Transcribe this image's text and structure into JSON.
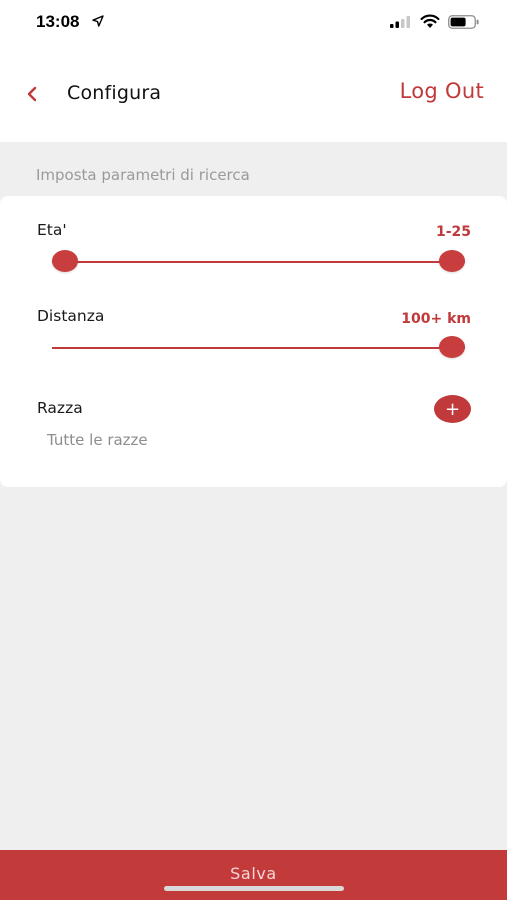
{
  "status_bar": {
    "time": "13:08",
    "icons": [
      "location-arrow-icon",
      "signal-icon",
      "wifi-icon",
      "battery-icon"
    ]
  },
  "nav": {
    "back_icon": "chevron-left-icon",
    "title": "Configura",
    "logout_label": "Log Out"
  },
  "section": {
    "label": "Imposta parametri di ricerca"
  },
  "filters": {
    "age": {
      "label": "Eta'",
      "value": "1-25",
      "range_min_fraction": 0.0,
      "range_max_fraction": 1.0
    },
    "distance": {
      "label": "Distanza",
      "value": "100+ km",
      "level_fraction": 1.0
    },
    "breed": {
      "label": "Razza",
      "add_icon": "plus-icon",
      "add_symbol": "+",
      "value": "Tutte le razze"
    }
  },
  "footer": {
    "save_label": "Salva"
  },
  "colors": {
    "accent": "#c0393b",
    "background": "#efefef"
  }
}
